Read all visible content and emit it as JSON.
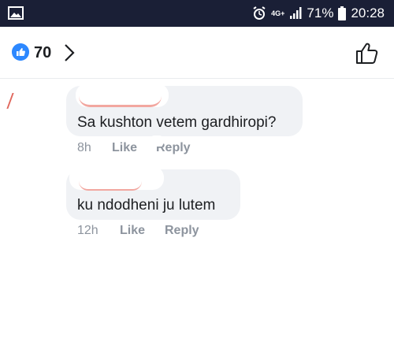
{
  "status_bar": {
    "network": "4G+",
    "battery": "71%",
    "time": "20:28",
    "icons": [
      "image-icon",
      "alarm-icon",
      "signal-icon",
      "battery-icon"
    ]
  },
  "header": {
    "like_count": "70",
    "icons": [
      "like-badge-icon",
      "chevron-right-icon",
      "thumbs-up-icon"
    ]
  },
  "comments": [
    {
      "text": "Sa kushton vetem gardhiropi?",
      "time": "8h",
      "like": "Like",
      "reply": "Reply"
    },
    {
      "text": "ku ndodheni ju lutem",
      "time": "12h",
      "like": "Like",
      "reply": "Reply"
    }
  ],
  "colors": {
    "status_bar": "#1a1f36",
    "accent": "#2d88ff",
    "bubble": "#f0f2f5",
    "meta": "#8d949e"
  }
}
